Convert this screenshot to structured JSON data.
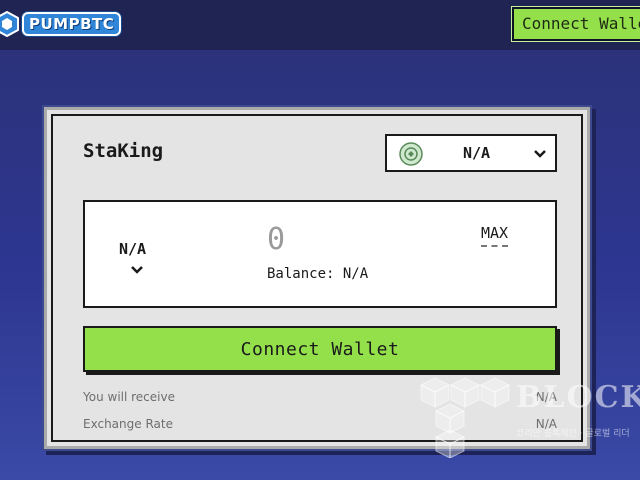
{
  "header": {
    "logo_text": "PUMPBTC",
    "connect_label": "Connect Wallet"
  },
  "card": {
    "title": "StaKing",
    "token_select": {
      "value": "N/A",
      "icon": "token-coin-icon"
    },
    "stake_box": {
      "asset": "N/A",
      "amount": "0",
      "balance": "Balance: N/A",
      "max_label": "MAX"
    },
    "connect_label": "Connect Wallet",
    "info": [
      {
        "label": "You will receive",
        "value": "N/A"
      },
      {
        "label": "Exchange Rate",
        "value": "N/A"
      }
    ]
  },
  "watermark": {
    "text": "BLOCK",
    "subtext": "코리안 블록체인 · 글로벌 리더"
  },
  "colors": {
    "background": "#2d3690",
    "header": "#1f2452",
    "accent_green": "#93e04b",
    "card": "#e4e4e4"
  }
}
